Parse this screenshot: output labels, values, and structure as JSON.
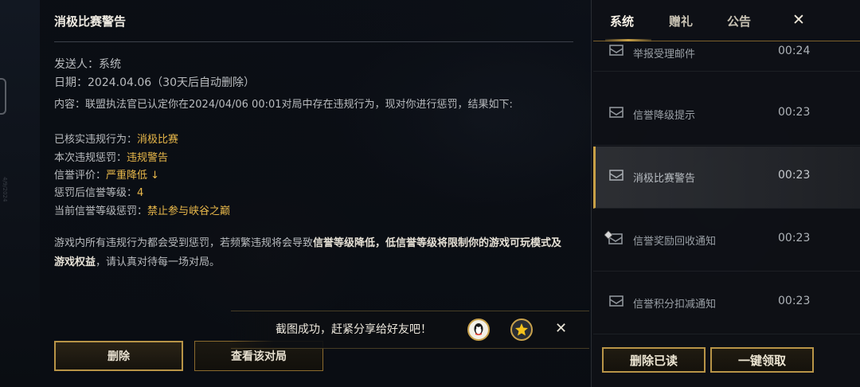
{
  "detail": {
    "title": "消极比赛警告",
    "sender": "发送人：系统",
    "date_label": "日期：",
    "date_value": "2024.04.06",
    "date_note": "（30天后自动删除）",
    "content": "内容：联盟执法官已认定你在2024/04/06 00:01对局中存在违规行为，现对你进行惩罚，结果如下:",
    "violations": [
      {
        "label": "已核实违规行为：",
        "value": "消极比赛"
      },
      {
        "label": "本次违规惩罚：",
        "value": "违规警告"
      },
      {
        "label": "信誉评价：",
        "value": "严重降低 ↓"
      },
      {
        "label": "惩罚后信誉等级：",
        "value": "4"
      },
      {
        "label": "当前信誉等级惩罚：",
        "value": "禁止参与峡谷之巅"
      }
    ],
    "paragraph": {
      "part1": "游戏内所有违规行为都会受到惩罚，若频繁违规将会导致",
      "bold1": "信誉等级降低，低信誉等级将限制你的游戏可玩模式及游戏权益",
      "part2": "，请认真对待每一场对局。"
    },
    "delete_button": "删除",
    "view_match_button": "查看该对局"
  },
  "toast": {
    "text": "截图成功，赶紧分享给好友吧！",
    "icons": [
      "qq-icon",
      "qzone-star-icon"
    ]
  },
  "side_watermark": "4/9/2024",
  "sidebar": {
    "tabs": [
      "系统",
      "赠礼",
      "公告"
    ],
    "active_tab": 0,
    "mails": [
      {
        "subject": "举报受理邮件",
        "time": "00:24",
        "icon": "mail-open-icon"
      },
      {
        "subject": "信誉降级提示",
        "time": "00:23",
        "icon": "mail-open-icon"
      },
      {
        "subject": "消极比赛警告",
        "time": "00:23",
        "icon": "mail-open-icon",
        "selected": true
      },
      {
        "subject": "信誉奖励回收通知",
        "time": "00:23",
        "icon": "mail-attachment-icon"
      },
      {
        "subject": "信誉积分扣减通知",
        "time": "00:23",
        "icon": "mail-open-icon"
      }
    ],
    "delete_read_button": "删除已读",
    "claim_all_button": "一键领取"
  },
  "colors": {
    "accent_gold": "#c8a046",
    "highlight_text": "#e8b84a"
  }
}
